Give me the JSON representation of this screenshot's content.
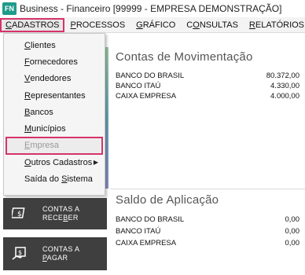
{
  "app": {
    "badge": "FN",
    "title": "Business - Financeiro  [99999 - EMPRESA DEMONSTRAÇÃO]"
  },
  "menubar": [
    {
      "first": "C",
      "rest": "ADASTROS",
      "active": true
    },
    {
      "first": "P",
      "rest": "ROCESSOS"
    },
    {
      "first": "G",
      "rest": "RÁFICO"
    },
    {
      "first": "CO",
      "rest": "NSULTAS"
    },
    {
      "first": "R",
      "rest": "ELATÓRIOS"
    }
  ],
  "dropdown": {
    "items": [
      {
        "first": "C",
        "rest": "lientes"
      },
      {
        "first": "F",
        "rest": "ornecedores"
      },
      {
        "first": "V",
        "rest": "endedores"
      },
      {
        "first": "R",
        "rest": "epresentantes"
      },
      {
        "first": "B",
        "rest": "ancos"
      },
      {
        "first": "M",
        "rest": "unicípios"
      },
      {
        "first": "E",
        "rest": "mpresa",
        "disabled": true,
        "highlight": true
      },
      {
        "first": "O",
        "rest": "utros Cadastros",
        "submenu": true
      },
      {
        "label_pre": "Saída do ",
        "first": "S",
        "rest": "istema"
      }
    ]
  },
  "tiles": {
    "receber": {
      "line1": "CONTAS A",
      "line2_pre": "RECE",
      "line2_u": "B",
      "line2_post": "ER",
      "icon": "dollar-receipt-icon"
    },
    "pagar": {
      "line1": "CONTAS A",
      "line2_u": "P",
      "line2_post": "AGAR",
      "icon": "dollar-payment-icon"
    }
  },
  "movimentacao": {
    "title": "Contas de Movimentação",
    "rows": [
      {
        "name": "BANCO DO BRASIL",
        "value": "80.372,00"
      },
      {
        "name": "BANCO ITAÚ",
        "value": "4.330,00"
      },
      {
        "name": "CAIXA EMPRESA",
        "value": "4.000,00"
      }
    ]
  },
  "aplicacao": {
    "title": "Saldo de Aplicação",
    "rows": [
      {
        "name": "BANCO DO BRASIL",
        "value": "0,00"
      },
      {
        "name": "BANCO ITAÚ",
        "value": "0,00"
      },
      {
        "name": "CAIXA EMPRESA",
        "value": "0,00"
      }
    ]
  },
  "colors": {
    "highlight": "#d6336c",
    "brand": "#1e9b8a",
    "tile": "#3f3f3f"
  }
}
